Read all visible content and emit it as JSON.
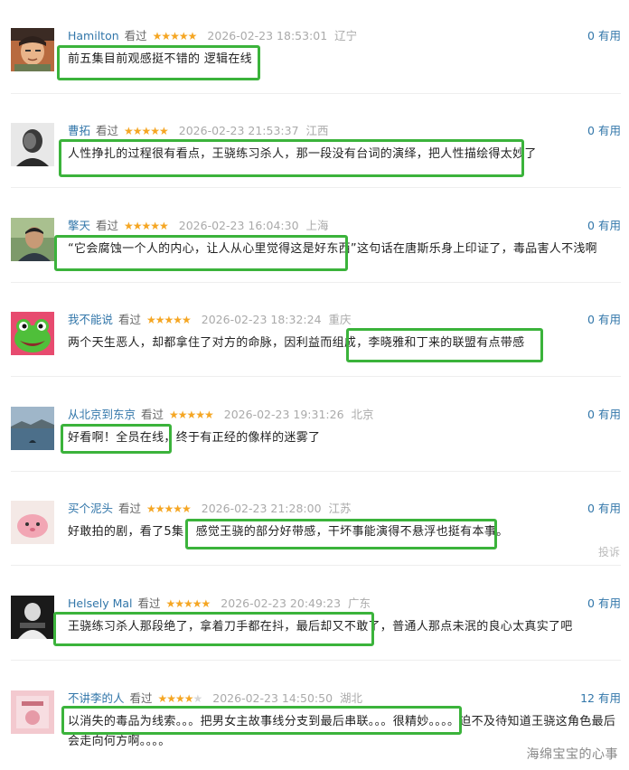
{
  "reviews": [
    {
      "user": "Hamilton",
      "watched": "看过",
      "rating": 5,
      "time": "2026-02-23 18:53:01",
      "location": "辽宁",
      "count": "0",
      "useful": "有用",
      "content": "前五集目前观感挺不错的 逻辑在线"
    },
    {
      "user": "曹拓",
      "watched": "看过",
      "rating": 5,
      "time": "2026-02-23 21:53:37",
      "location": "江西",
      "count": "0",
      "useful": "有用",
      "content": "人性挣扎的过程很有看点，王骁练习杀人，那一段没有台词的演绎，把人性描绘得太妙了"
    },
    {
      "user": "擎天",
      "watched": "看过",
      "rating": 5,
      "time": "2026-02-23 16:04:30",
      "location": "上海",
      "count": "0",
      "useful": "有用",
      "content": "“它会腐蚀一个人的内心，让人从心里觉得这是好东西”这句话在唐斯乐身上印证了，毒品害人不浅啊"
    },
    {
      "user": "我不能说",
      "watched": "看过",
      "rating": 5,
      "time": "2026-02-23 18:32:24",
      "location": "重庆",
      "count": "0",
      "useful": "有用",
      "content": "两个天生恶人，却都拿住了对方的命脉，因利益而组成，李晓雅和丁来的联盟有点带感"
    },
    {
      "user": "从北京到东京",
      "watched": "看过",
      "rating": 5,
      "time": "2026-02-23 19:31:26",
      "location": "北京",
      "count": "0",
      "useful": "有用",
      "content": "好看啊！全员在线，终于有正经的像样的迷雾了"
    },
    {
      "user": "买个泥头",
      "watched": "看过",
      "rating": 5,
      "time": "2026-02-23 21:28:00",
      "location": "江苏",
      "count": "0",
      "useful": "有用",
      "content": "好敢拍的剧，看了5集，感觉王骁的部分好带感，干坏事能演得不悬浮也挺有本事。",
      "report": "投诉"
    },
    {
      "user": "Helsely Mal",
      "watched": "看过",
      "rating": 5,
      "time": "2026-02-23 20:49:23",
      "location": "广东",
      "count": "0",
      "useful": "有用",
      "content": "王骁练习杀人那段绝了，拿着刀手都在抖，最后却又不敢了，普通人那点未泯的良心太真实了吧"
    },
    {
      "user": "不讲李的人",
      "watched": "看过",
      "rating": 4,
      "time": "2026-02-23 14:50:50",
      "location": "湖北",
      "count": "12",
      "useful": "有用",
      "content": "以消失的毒品为线索。。。把男女主故事线分支到最后串联。。。很精妙。。。。迫不及待知道王骁这角色最后会走向何方啊。。。。"
    }
  ],
  "avatars": [
    "cartoon-man-avatar-icon",
    "blurred-portrait-avatar-icon",
    "man-portrait-avatar-icon",
    "green-frog-avatar-icon",
    "lake-landscape-avatar-icon",
    "pink-plush-avatar-icon",
    "dark-figure-avatar-icon",
    "pink-poster-avatar-icon"
  ],
  "colors": {
    "link": "#3377aa",
    "star": "#f5a623",
    "highlight": "#3bb33b"
  },
  "watermark": "海绵宝宝的心事"
}
